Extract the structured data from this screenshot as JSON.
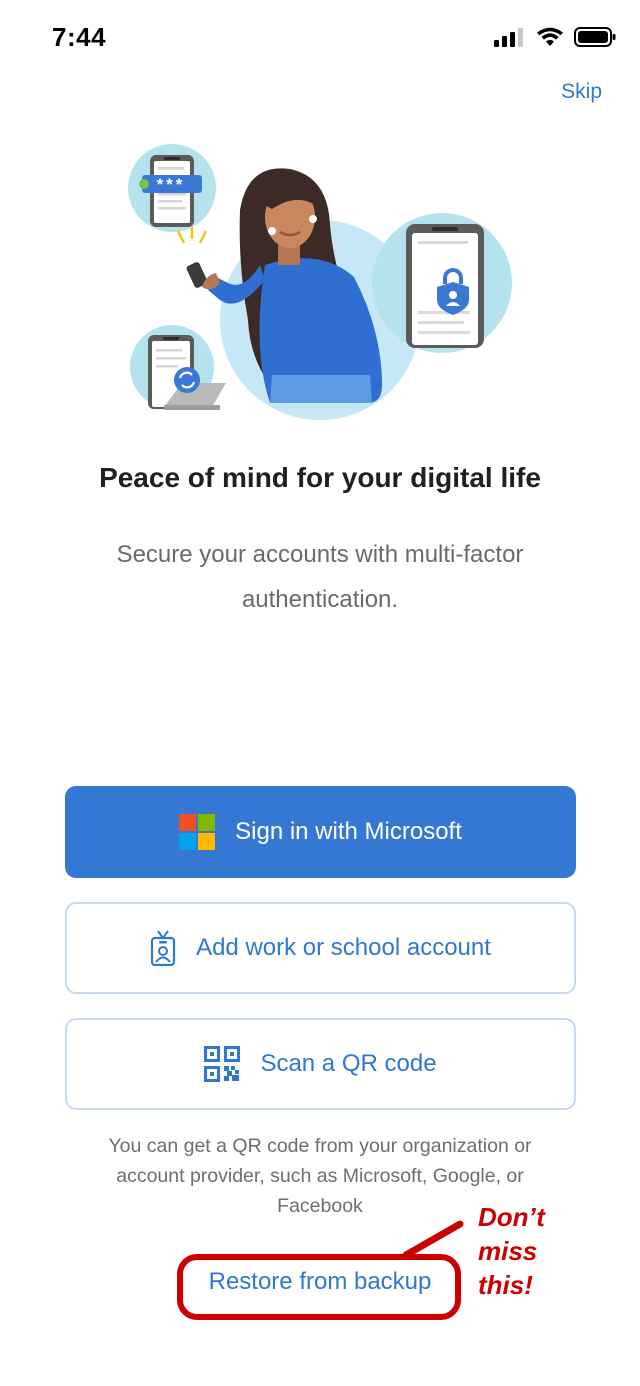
{
  "status_bar": {
    "time": "7:44"
  },
  "header": {
    "skip_label": "Skip"
  },
  "intro": {
    "headline": "Peace of mind for your digital life",
    "subtext": "Secure your accounts with multi-factor authentication.",
    "password_mask": "***"
  },
  "actions": {
    "sign_in_label": "Sign in with Microsoft",
    "work_account_label": "Add work or school account",
    "scan_qr_label": "Scan a QR code",
    "qr_hint": "You can get a QR code from your organization or account provider, such as Microsoft, Google, or Facebook",
    "restore_label": "Restore from backup"
  },
  "annotation": {
    "lines": [
      "Don’t",
      "miss",
      "this!"
    ],
    "color": "#cc0000"
  },
  "colors": {
    "accent": "#3478d4",
    "link": "#2f78d0",
    "microsoft_logo": [
      "#f25022",
      "#7fba00",
      "#00a4ef",
      "#ffb900"
    ]
  },
  "icons": {
    "status": [
      "cellular-signal-icon",
      "wifi-icon",
      "battery-icon"
    ],
    "buttons": [
      "microsoft-logo-icon",
      "id-badge-icon",
      "qr-code-icon"
    ]
  }
}
